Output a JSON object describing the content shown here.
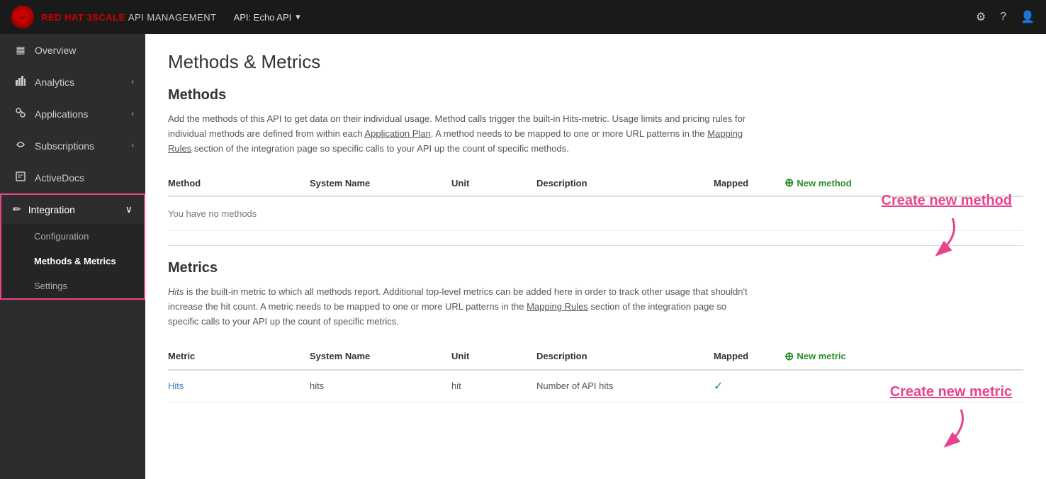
{
  "header": {
    "brand": "RED HAT 3SCALE",
    "subtitle": "API MANAGEMENT",
    "api_selector": "API: Echo API",
    "gear_icon": "⚙",
    "help_icon": "?",
    "user_icon": "👤"
  },
  "sidebar": {
    "items": [
      {
        "id": "overview",
        "label": "Overview",
        "icon": "▦",
        "has_arrow": false
      },
      {
        "id": "analytics",
        "label": "Analytics",
        "icon": "📊",
        "has_arrow": true
      },
      {
        "id": "applications",
        "label": "Applications",
        "icon": "🔗",
        "has_arrow": true
      },
      {
        "id": "subscriptions",
        "label": "Subscriptions",
        "icon": "♻",
        "has_arrow": true
      },
      {
        "id": "activedocs",
        "label": "ActiveDocs",
        "icon": "📄",
        "has_arrow": false
      }
    ],
    "integration": {
      "label": "Integration",
      "icon": "🔧",
      "sub_items": [
        {
          "id": "configuration",
          "label": "Configuration"
        },
        {
          "id": "methods-metrics",
          "label": "Methods & Metrics",
          "active": true
        },
        {
          "id": "settings",
          "label": "Settings"
        }
      ]
    }
  },
  "page": {
    "title": "Methods & Metrics",
    "methods_section": {
      "title": "Methods",
      "description": "Add the methods of this API to get data on their individual usage. Method calls trigger the built-in Hits-metric. Usage limits and pricing rules for individual methods are defined from within each Application Plan. A method needs to be mapped to one or more URL patterns in the Mapping Rules section of the integration page so specific calls to your API up the count of specific methods.",
      "application_plan_link": "Application Plan",
      "mapping_rules_link": "Mapping Rules",
      "columns": [
        {
          "id": "method",
          "label": "Method"
        },
        {
          "id": "system_name",
          "label": "System Name"
        },
        {
          "id": "unit",
          "label": "Unit"
        },
        {
          "id": "description",
          "label": "Description"
        },
        {
          "id": "mapped",
          "label": "Mapped"
        }
      ],
      "new_button": "New method",
      "no_data_message": "You have no methods",
      "rows": []
    },
    "metrics_section": {
      "title": "Metrics",
      "description": "Hits is the built-in metric to which all methods report. Additional top-level metrics can be added here in order to track other usage that shouldn't increase the hit count. A metric needs to be mapped to one or more URL patterns in the Mapping Rules section of the integration page so specific calls to your API up the count of specific metrics.",
      "mapping_rules_link": "Mapping Rules",
      "columns": [
        {
          "id": "metric",
          "label": "Metric"
        },
        {
          "id": "system_name",
          "label": "System Name"
        },
        {
          "id": "unit",
          "label": "Unit"
        },
        {
          "id": "description",
          "label": "Description"
        },
        {
          "id": "mapped",
          "label": "Mapped"
        }
      ],
      "new_button": "New metric",
      "rows": [
        {
          "metric": "Hits",
          "system_name": "hits",
          "unit": "hit",
          "description": "Number of API hits",
          "mapped": true
        }
      ]
    }
  },
  "annotations": {
    "methods": "Create new method",
    "metrics": "Create new metric"
  }
}
